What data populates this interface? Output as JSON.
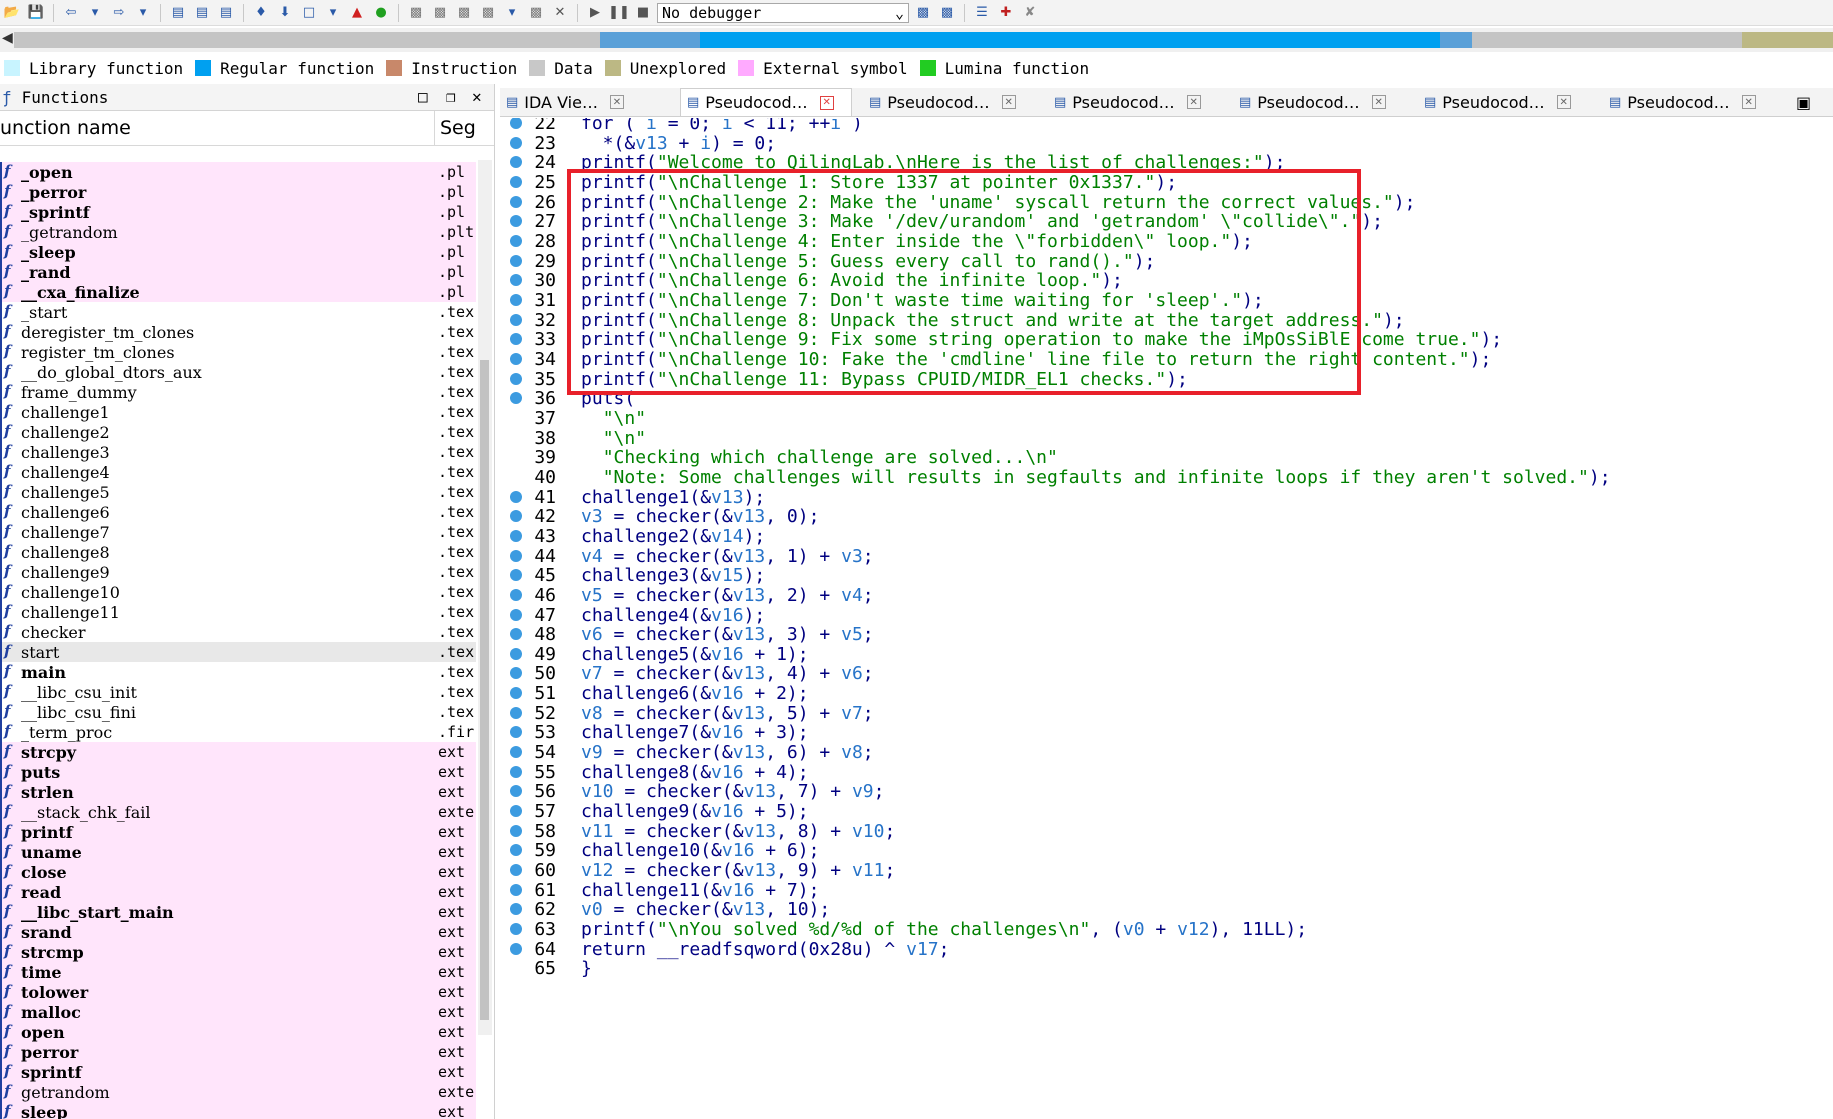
{
  "toolbar": {
    "debugger": "No debugger"
  },
  "legend": [
    {
      "label": "Library function",
      "color": "#c8f4ff"
    },
    {
      "label": "Regular function",
      "color": "#00a0f0"
    },
    {
      "label": "Instruction",
      "color": "#c8886a"
    },
    {
      "label": "Data",
      "color": "#c8c8c8"
    },
    {
      "label": "Unexplored",
      "color": "#bcb884"
    },
    {
      "label": "External symbol",
      "color": "#ffaaff"
    },
    {
      "label": "Lumina function",
      "color": "#22cc22"
    }
  ],
  "functions_panel": {
    "title": "Functions",
    "col_name": "unction name",
    "col_seg": "Seg",
    "rows": [
      {
        "name": "_open",
        "seg": ".pl",
        "type": "pink",
        "bold": true
      },
      {
        "name": "_perror",
        "seg": ".pl",
        "type": "pink",
        "bold": true
      },
      {
        "name": "_sprintf",
        "seg": ".pl",
        "type": "pink",
        "bold": true
      },
      {
        "name": "_getrandom",
        "seg": ".plt",
        "type": "pink",
        "bold": false
      },
      {
        "name": "_sleep",
        "seg": ".pl",
        "type": "pink",
        "bold": true
      },
      {
        "name": "_rand",
        "seg": ".pl",
        "type": "pink",
        "bold": true
      },
      {
        "name": "__cxa_finalize",
        "seg": ".pl",
        "type": "pink",
        "bold": true
      },
      {
        "name": "_start",
        "seg": ".tex",
        "type": "plain",
        "bold": false
      },
      {
        "name": "deregister_tm_clones",
        "seg": ".tex",
        "type": "plain",
        "bold": false
      },
      {
        "name": "register_tm_clones",
        "seg": ".tex",
        "type": "plain",
        "bold": false
      },
      {
        "name": "__do_global_dtors_aux",
        "seg": ".tex",
        "type": "plain",
        "bold": false
      },
      {
        "name": "frame_dummy",
        "seg": ".tex",
        "type": "plain",
        "bold": false
      },
      {
        "name": "challenge1",
        "seg": ".tex",
        "type": "plain",
        "bold": false
      },
      {
        "name": "challenge2",
        "seg": ".tex",
        "type": "plain",
        "bold": false
      },
      {
        "name": "challenge3",
        "seg": ".tex",
        "type": "plain",
        "bold": false
      },
      {
        "name": "challenge4",
        "seg": ".tex",
        "type": "plain",
        "bold": false
      },
      {
        "name": "challenge5",
        "seg": ".tex",
        "type": "plain",
        "bold": false
      },
      {
        "name": "challenge6",
        "seg": ".tex",
        "type": "plain",
        "bold": false
      },
      {
        "name": "challenge7",
        "seg": ".tex",
        "type": "plain",
        "bold": false
      },
      {
        "name": "challenge8",
        "seg": ".tex",
        "type": "plain",
        "bold": false
      },
      {
        "name": "challenge9",
        "seg": ".tex",
        "type": "plain",
        "bold": false
      },
      {
        "name": "challenge10",
        "seg": ".tex",
        "type": "plain",
        "bold": false
      },
      {
        "name": "challenge11",
        "seg": ".tex",
        "type": "plain",
        "bold": false
      },
      {
        "name": "checker",
        "seg": ".tex",
        "type": "plain",
        "bold": false
      },
      {
        "name": "start",
        "seg": ".tex",
        "type": "sel",
        "bold": false
      },
      {
        "name": "main",
        "seg": ".tex",
        "type": "plain",
        "bold": true
      },
      {
        "name": "__libc_csu_init",
        "seg": ".tex",
        "type": "plain",
        "bold": false
      },
      {
        "name": "__libc_csu_fini",
        "seg": ".tex",
        "type": "plain",
        "bold": false
      },
      {
        "name": "_term_proc",
        "seg": ".fir",
        "type": "plain",
        "bold": false
      },
      {
        "name": "strcpy",
        "seg": "ext",
        "type": "pink",
        "bold": true
      },
      {
        "name": "puts",
        "seg": "ext",
        "type": "pink",
        "bold": true
      },
      {
        "name": "strlen",
        "seg": "ext",
        "type": "pink",
        "bold": true
      },
      {
        "name": "__stack_chk_fail",
        "seg": "exte",
        "type": "pink",
        "bold": false
      },
      {
        "name": "printf",
        "seg": "ext",
        "type": "pink",
        "bold": true
      },
      {
        "name": "uname",
        "seg": "ext",
        "type": "pink",
        "bold": true
      },
      {
        "name": "close",
        "seg": "ext",
        "type": "pink",
        "bold": true
      },
      {
        "name": "read",
        "seg": "ext",
        "type": "pink",
        "bold": true
      },
      {
        "name": "__libc_start_main",
        "seg": "ext",
        "type": "pink",
        "bold": true
      },
      {
        "name": "srand",
        "seg": "ext",
        "type": "pink",
        "bold": true
      },
      {
        "name": "strcmp",
        "seg": "ext",
        "type": "pink",
        "bold": true
      },
      {
        "name": "time",
        "seg": "ext",
        "type": "pink",
        "bold": true
      },
      {
        "name": "tolower",
        "seg": "ext",
        "type": "pink",
        "bold": true
      },
      {
        "name": "malloc",
        "seg": "ext",
        "type": "pink",
        "bold": true
      },
      {
        "name": "open",
        "seg": "ext",
        "type": "pink",
        "bold": true
      },
      {
        "name": "perror",
        "seg": "ext",
        "type": "pink",
        "bold": true
      },
      {
        "name": "sprintf",
        "seg": "ext",
        "type": "pink",
        "bold": true
      },
      {
        "name": "getrandom",
        "seg": "exte",
        "type": "pink",
        "bold": false
      },
      {
        "name": "sleep",
        "seg": "ext",
        "type": "pink",
        "bold": true
      }
    ]
  },
  "tabs": [
    {
      "label": "IDA Vie…",
      "active": false
    },
    {
      "label": "Pseudocod…",
      "active": true
    },
    {
      "label": "Pseudocod…",
      "active": false
    },
    {
      "label": "Pseudocod…",
      "active": false
    },
    {
      "label": "Pseudocod…",
      "active": false
    },
    {
      "label": "Pseudocod…",
      "active": false
    },
    {
      "label": "Pseudocod…",
      "active": false
    }
  ],
  "code": [
    {
      "n": "22",
      "dot": true,
      "text": "for ( i = 0; i < 11; ++i )"
    },
    {
      "n": "23",
      "dot": true,
      "text": "  *(&v13 + i) = 0;"
    },
    {
      "n": "24",
      "dot": true,
      "text": "printf(\"Welcome to QilingLab.\\nHere is the list of challenges:\");"
    },
    {
      "n": "25",
      "dot": true,
      "text": "printf(\"\\nChallenge 1: Store 1337 at pointer 0x1337.\");"
    },
    {
      "n": "26",
      "dot": true,
      "text": "printf(\"\\nChallenge 2: Make the 'uname' syscall return the correct values.\");"
    },
    {
      "n": "27",
      "dot": true,
      "text": "printf(\"\\nChallenge 3: Make '/dev/urandom' and 'getrandom' \\\"collide\\\".\");"
    },
    {
      "n": "28",
      "dot": true,
      "text": "printf(\"\\nChallenge 4: Enter inside the \\\"forbidden\\\" loop.\");"
    },
    {
      "n": "29",
      "dot": true,
      "text": "printf(\"\\nChallenge 5: Guess every call to rand().\");"
    },
    {
      "n": "30",
      "dot": true,
      "text": "printf(\"\\nChallenge 6: Avoid the infinite loop.\");"
    },
    {
      "n": "31",
      "dot": true,
      "text": "printf(\"\\nChallenge 7: Don't waste time waiting for 'sleep'.\");"
    },
    {
      "n": "32",
      "dot": true,
      "text": "printf(\"\\nChallenge 8: Unpack the struct and write at the target address.\");"
    },
    {
      "n": "33",
      "dot": true,
      "text": "printf(\"\\nChallenge 9: Fix some string operation to make the iMpOsSiBlE come true.\");"
    },
    {
      "n": "34",
      "dot": true,
      "text": "printf(\"\\nChallenge 10: Fake the 'cmdline' line file to return the right content.\");"
    },
    {
      "n": "35",
      "dot": true,
      "text": "printf(\"\\nChallenge 11: Bypass CPUID/MIDR_EL1 checks.\");"
    },
    {
      "n": "36",
      "dot": true,
      "text": "puts("
    },
    {
      "n": "37",
      "dot": false,
      "text": "  \"\\n\""
    },
    {
      "n": "38",
      "dot": false,
      "text": "  \"\\n\""
    },
    {
      "n": "39",
      "dot": false,
      "text": "  \"Checking which challenge are solved...\\n\""
    },
    {
      "n": "40",
      "dot": false,
      "text": "  \"Note: Some challenges will results in segfaults and infinite loops if they aren't solved.\");"
    },
    {
      "n": "41",
      "dot": true,
      "text": "challenge1(&v13);"
    },
    {
      "n": "42",
      "dot": true,
      "text": "v3 = checker(&v13, 0);"
    },
    {
      "n": "43",
      "dot": true,
      "text": "challenge2(&v14);"
    },
    {
      "n": "44",
      "dot": true,
      "text": "v4 = checker(&v13, 1) + v3;"
    },
    {
      "n": "45",
      "dot": true,
      "text": "challenge3(&v15);"
    },
    {
      "n": "46",
      "dot": true,
      "text": "v5 = checker(&v13, 2) + v4;"
    },
    {
      "n": "47",
      "dot": true,
      "text": "challenge4(&v16);"
    },
    {
      "n": "48",
      "dot": true,
      "text": "v6 = checker(&v13, 3) + v5;"
    },
    {
      "n": "49",
      "dot": true,
      "text": "challenge5(&v16 + 1);"
    },
    {
      "n": "50",
      "dot": true,
      "text": "v7 = checker(&v13, 4) + v6;"
    },
    {
      "n": "51",
      "dot": true,
      "text": "challenge6(&v16 + 2);"
    },
    {
      "n": "52",
      "dot": true,
      "text": "v8 = checker(&v13, 5) + v7;"
    },
    {
      "n": "53",
      "dot": true,
      "text": "challenge7(&v16 + 3);"
    },
    {
      "n": "54",
      "dot": true,
      "text": "v9 = checker(&v13, 6) + v8;"
    },
    {
      "n": "55",
      "dot": true,
      "text": "challenge8(&v16 + 4);"
    },
    {
      "n": "56",
      "dot": true,
      "text": "v10 = checker(&v13, 7) + v9;"
    },
    {
      "n": "57",
      "dot": true,
      "text": "challenge9(&v16 + 5);"
    },
    {
      "n": "58",
      "dot": true,
      "text": "v11 = checker(&v13, 8) + v10;"
    },
    {
      "n": "59",
      "dot": true,
      "text": "challenge10(&v16 + 6);"
    },
    {
      "n": "60",
      "dot": true,
      "text": "v12 = checker(&v13, 9) + v11;"
    },
    {
      "n": "61",
      "dot": true,
      "text": "challenge11(&v16 + 7);"
    },
    {
      "n": "62",
      "dot": true,
      "text": "v0 = checker(&v13, 10);"
    },
    {
      "n": "63",
      "dot": true,
      "text": "printf(\"\\nYou solved %d/%d of the challenges\\n\", (v0 + v12), 11LL);"
    },
    {
      "n": "64",
      "dot": true,
      "text": "return __readfsqword(0x28u) ^ v17;"
    },
    {
      "n": "65",
      "dot": false,
      "text": "}"
    }
  ]
}
